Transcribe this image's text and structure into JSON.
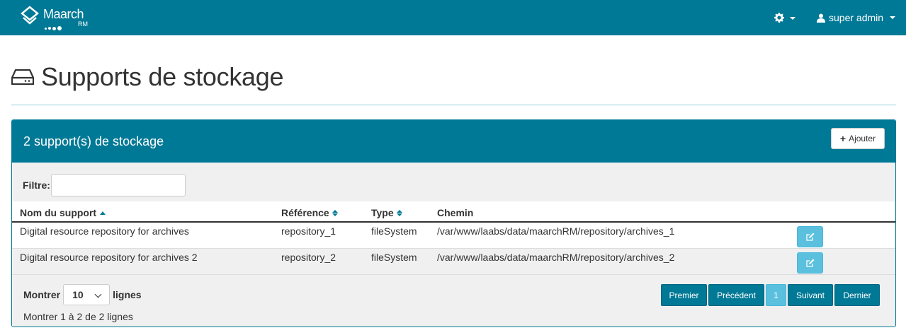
{
  "navbar": {
    "brand_name": "Maarch",
    "brand_sub": "RM",
    "settings_icon": "gear-icon",
    "user_icon": "user-icon",
    "user_name": "super admin",
    "colors": {
      "primary": "#007996",
      "info": "#5bc0de"
    }
  },
  "page": {
    "icon": "hdd-icon",
    "title": "Supports de stockage"
  },
  "panel": {
    "title": "2 support(s) de stockage",
    "add_label": "Ajouter",
    "filter_label": "Filtre:",
    "filter_value": "",
    "columns": [
      "Nom du support",
      "Référence",
      "Type",
      "Chemin"
    ],
    "rows": [
      {
        "name": "Digital resource repository for archives",
        "reference": "repository_1",
        "type": "fileSystem",
        "path": "/var/www/laabs/data/maarchRM/repository/archives_1"
      },
      {
        "name": "Digital resource repository for archives 2",
        "reference": "repository_2",
        "type": "fileSystem",
        "path": "/var/www/laabs/data/maarchRM/repository/archives_2"
      }
    ],
    "length_label_before": "Montrer",
    "length_value": "10",
    "length_label_after": "lignes",
    "info": "Montrer 1 à 2 de 2 lignes",
    "pagination": {
      "first": "Premier",
      "previous": "Précédent",
      "current": "1",
      "next": "Suivant",
      "last": "Dernier"
    }
  }
}
